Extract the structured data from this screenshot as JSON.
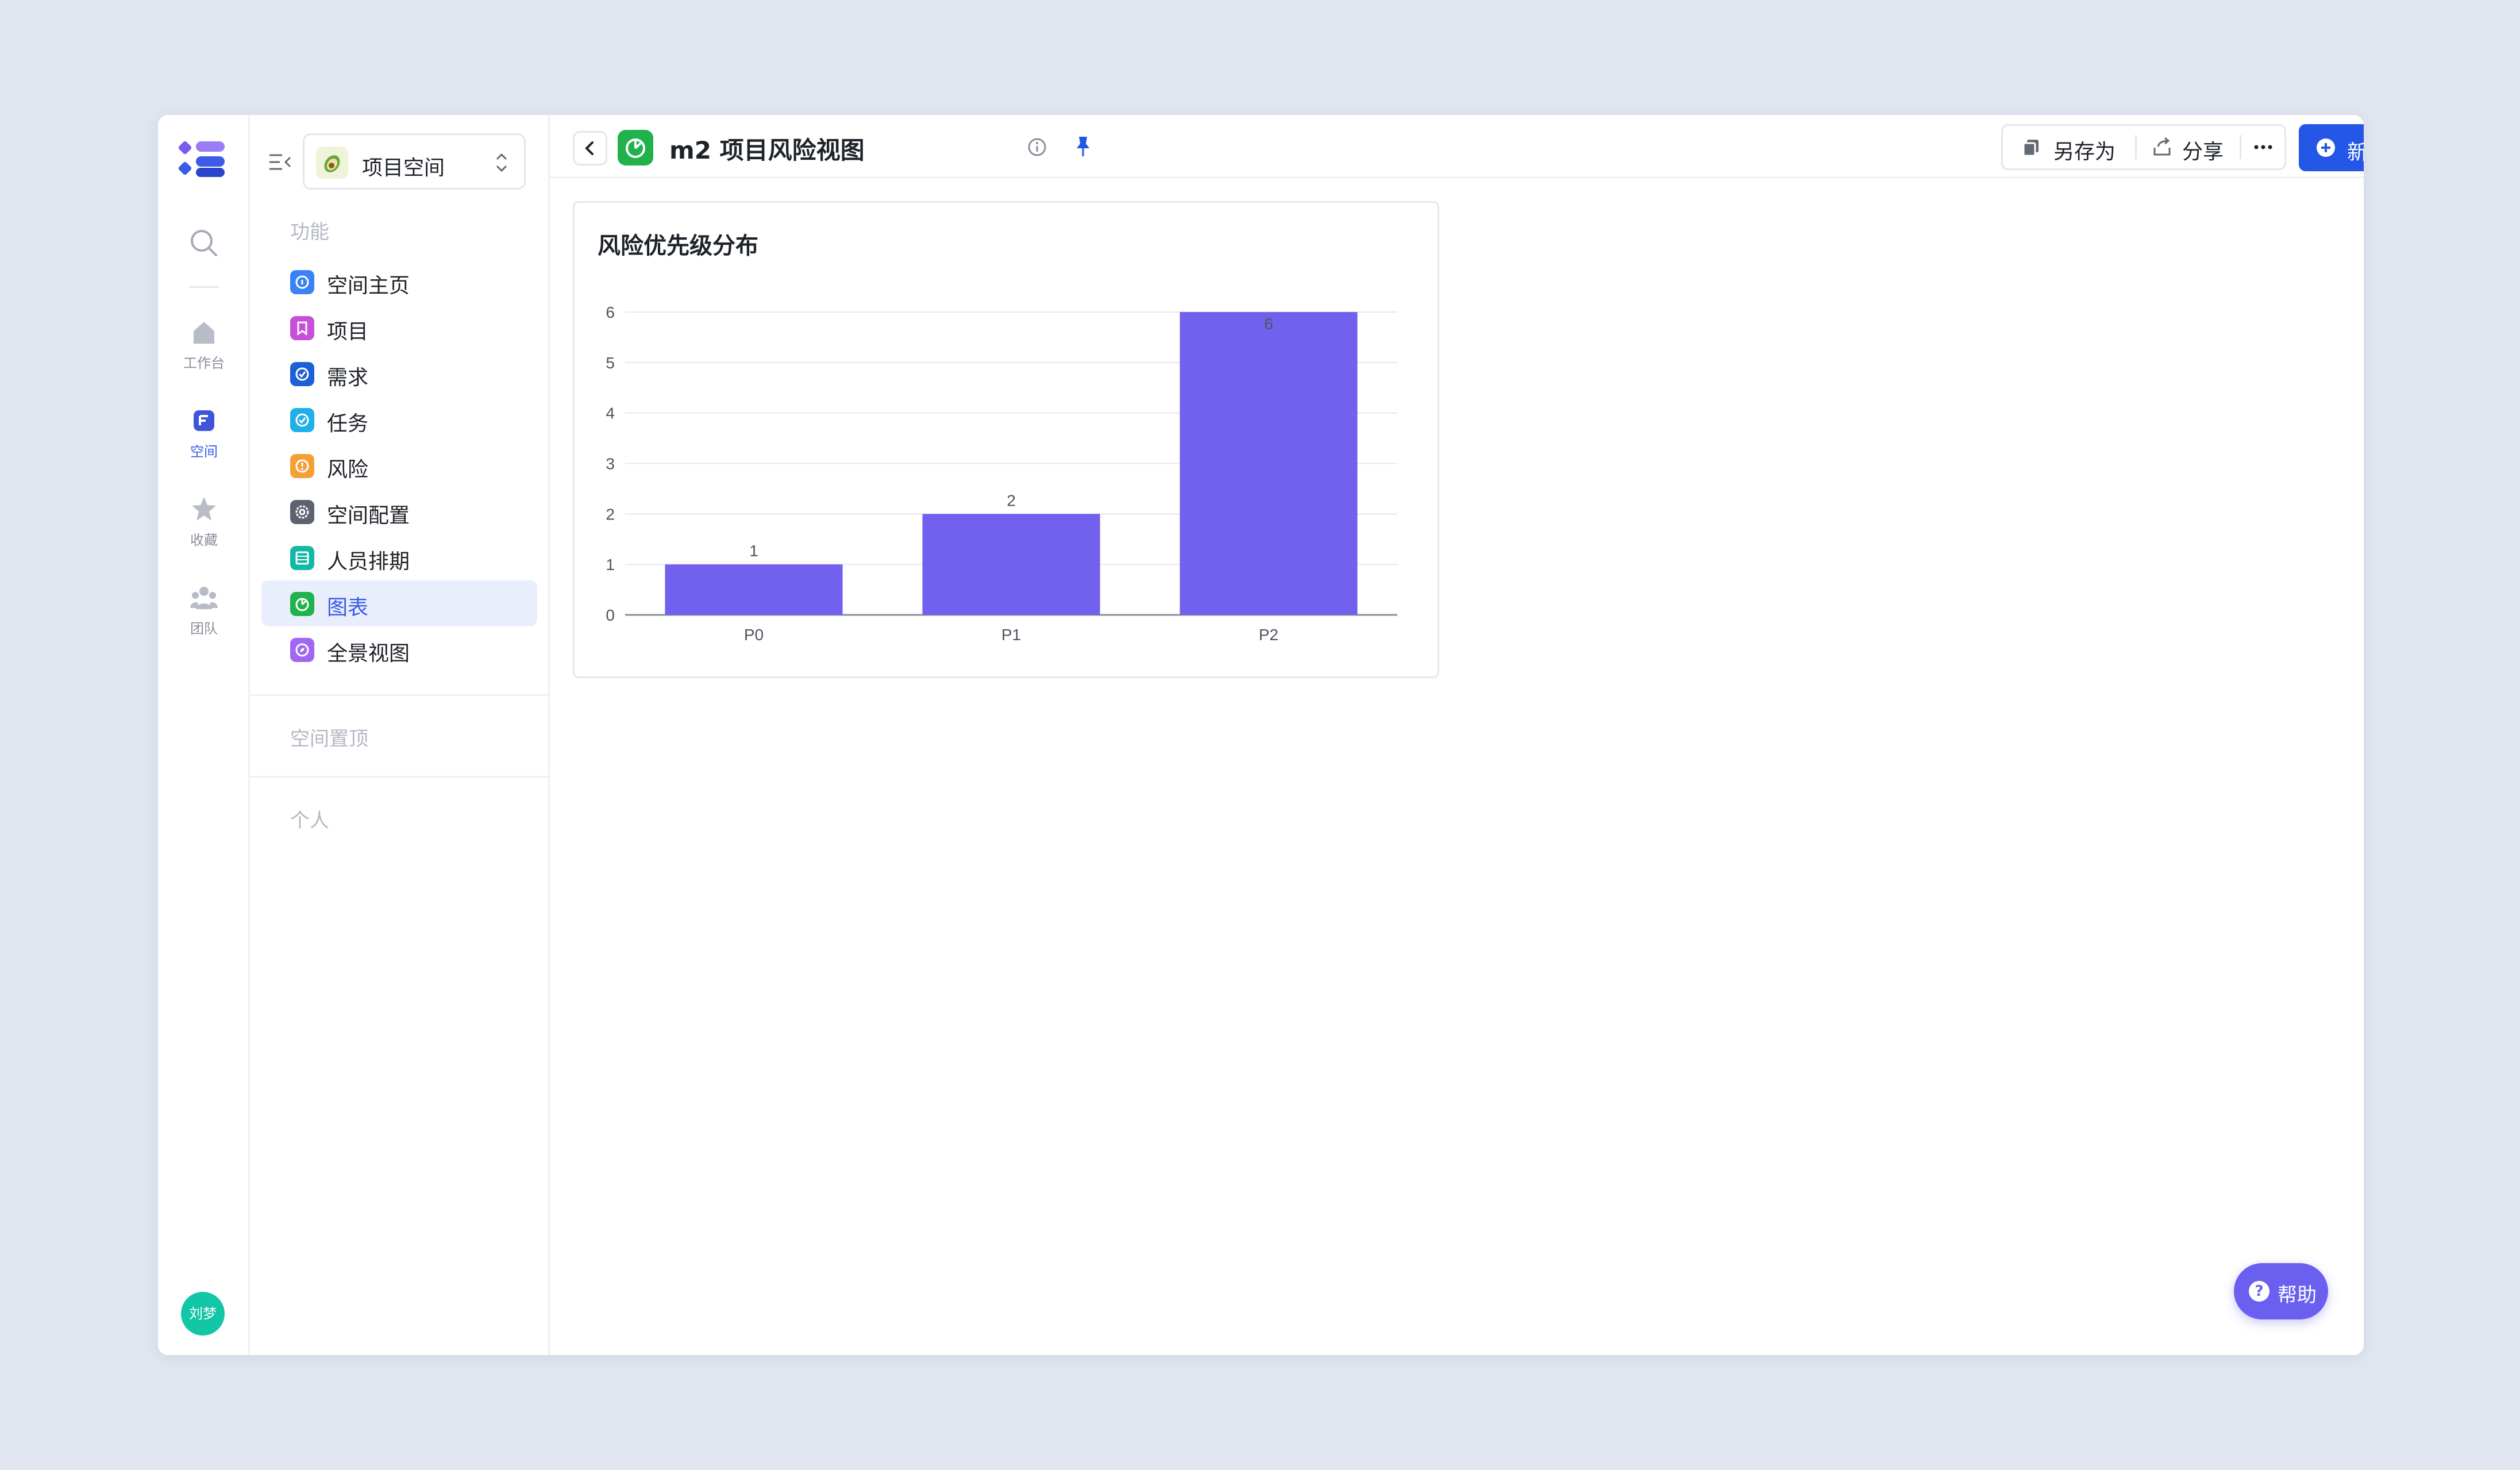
{
  "rail": {
    "items": [
      {
        "label": "工作台",
        "icon": "home-icon"
      },
      {
        "label": "空间",
        "icon": "space-icon",
        "active": true
      },
      {
        "label": "收藏",
        "icon": "star-icon"
      },
      {
        "label": "团队",
        "icon": "team-icon"
      }
    ],
    "avatar": "刘梦"
  },
  "sidebar": {
    "space_name": "项目空间",
    "section_features": "功能",
    "items": [
      {
        "label": "空间主页",
        "color": "#3b82f6"
      },
      {
        "label": "项目",
        "color": "#c84fd8"
      },
      {
        "label": "需求",
        "color": "#1d5fd6"
      },
      {
        "label": "任务",
        "color": "#1fb0e8"
      },
      {
        "label": "风险",
        "color": "#f5a037"
      },
      {
        "label": "空间配置",
        "color": "#5d6170"
      },
      {
        "label": "人员排期",
        "color": "#14b8a6"
      },
      {
        "label": "图表",
        "color": "#22b24c",
        "active": true
      },
      {
        "label": "全景视图",
        "color": "#a167f2"
      }
    ],
    "section_pinned": "空间置顶",
    "section_personal": "个人"
  },
  "topbar": {
    "title": "m2 项目风险视图",
    "save_as": "另存为",
    "share": "分享",
    "new": "新建"
  },
  "chart_data": {
    "type": "bar",
    "title": "风险优先级分布",
    "categories": [
      "P0",
      "P1",
      "P2"
    ],
    "values": [
      1,
      2,
      6
    ],
    "ylim": [
      0,
      6
    ],
    "yticks": [
      0,
      1,
      2,
      3,
      4,
      5,
      6
    ],
    "color": "#7260ef",
    "grid": true,
    "data_labels": true
  },
  "help": "帮助",
  "colors": {
    "accent": "#2456e8",
    "active_bg": "#e9eefc",
    "bar": "#7260ef"
  }
}
